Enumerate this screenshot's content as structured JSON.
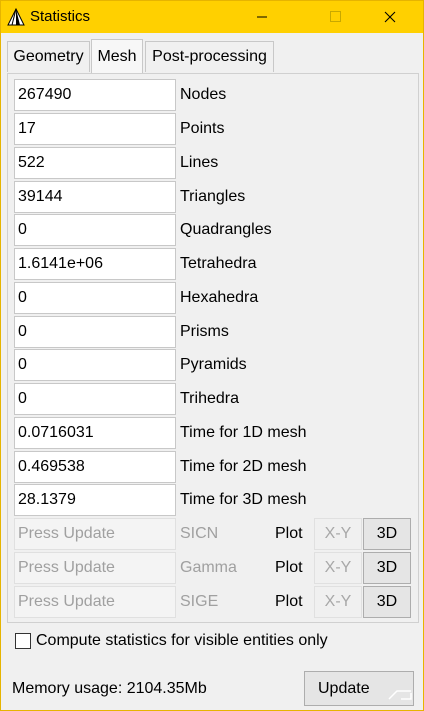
{
  "window": {
    "title": "Statistics"
  },
  "tabs": [
    "Geometry",
    "Mesh",
    "Post-processing"
  ],
  "mesh_stats": [
    {
      "value": "267490",
      "label": "Nodes"
    },
    {
      "value": "17",
      "label": "Points"
    },
    {
      "value": "522",
      "label": "Lines"
    },
    {
      "value": "39144",
      "label": "Triangles"
    },
    {
      "value": "0",
      "label": "Quadrangles"
    },
    {
      "value": "1.6141e+06",
      "label": "Tetrahedra"
    },
    {
      "value": "0",
      "label": "Hexahedra"
    },
    {
      "value": "0",
      "label": "Prisms"
    },
    {
      "value": "0",
      "label": "Pyramids"
    },
    {
      "value": "0",
      "label": "Trihedra"
    },
    {
      "value": "0.0716031",
      "label": "Time for 1D mesh"
    },
    {
      "value": "0.469538",
      "label": "Time for 2D mesh"
    },
    {
      "value": "28.1379",
      "label": "Time for 3D mesh"
    }
  ],
  "quality_rows": [
    {
      "value": "Press Update",
      "label": "SICN",
      "plot": "Plot",
      "xy": "X-Y",
      "d3": "3D"
    },
    {
      "value": "Press Update",
      "label": "Gamma",
      "plot": "Plot",
      "xy": "X-Y",
      "d3": "3D"
    },
    {
      "value": "Press Update",
      "label": "SIGE",
      "plot": "Plot",
      "xy": "X-Y",
      "d3": "3D"
    }
  ],
  "visible_only_label": "Compute statistics for visible entities only",
  "memory_usage": "Memory usage: 2104.35Mb",
  "update_label": "Update",
  "colors": {
    "titlebar": "#ffd000"
  }
}
